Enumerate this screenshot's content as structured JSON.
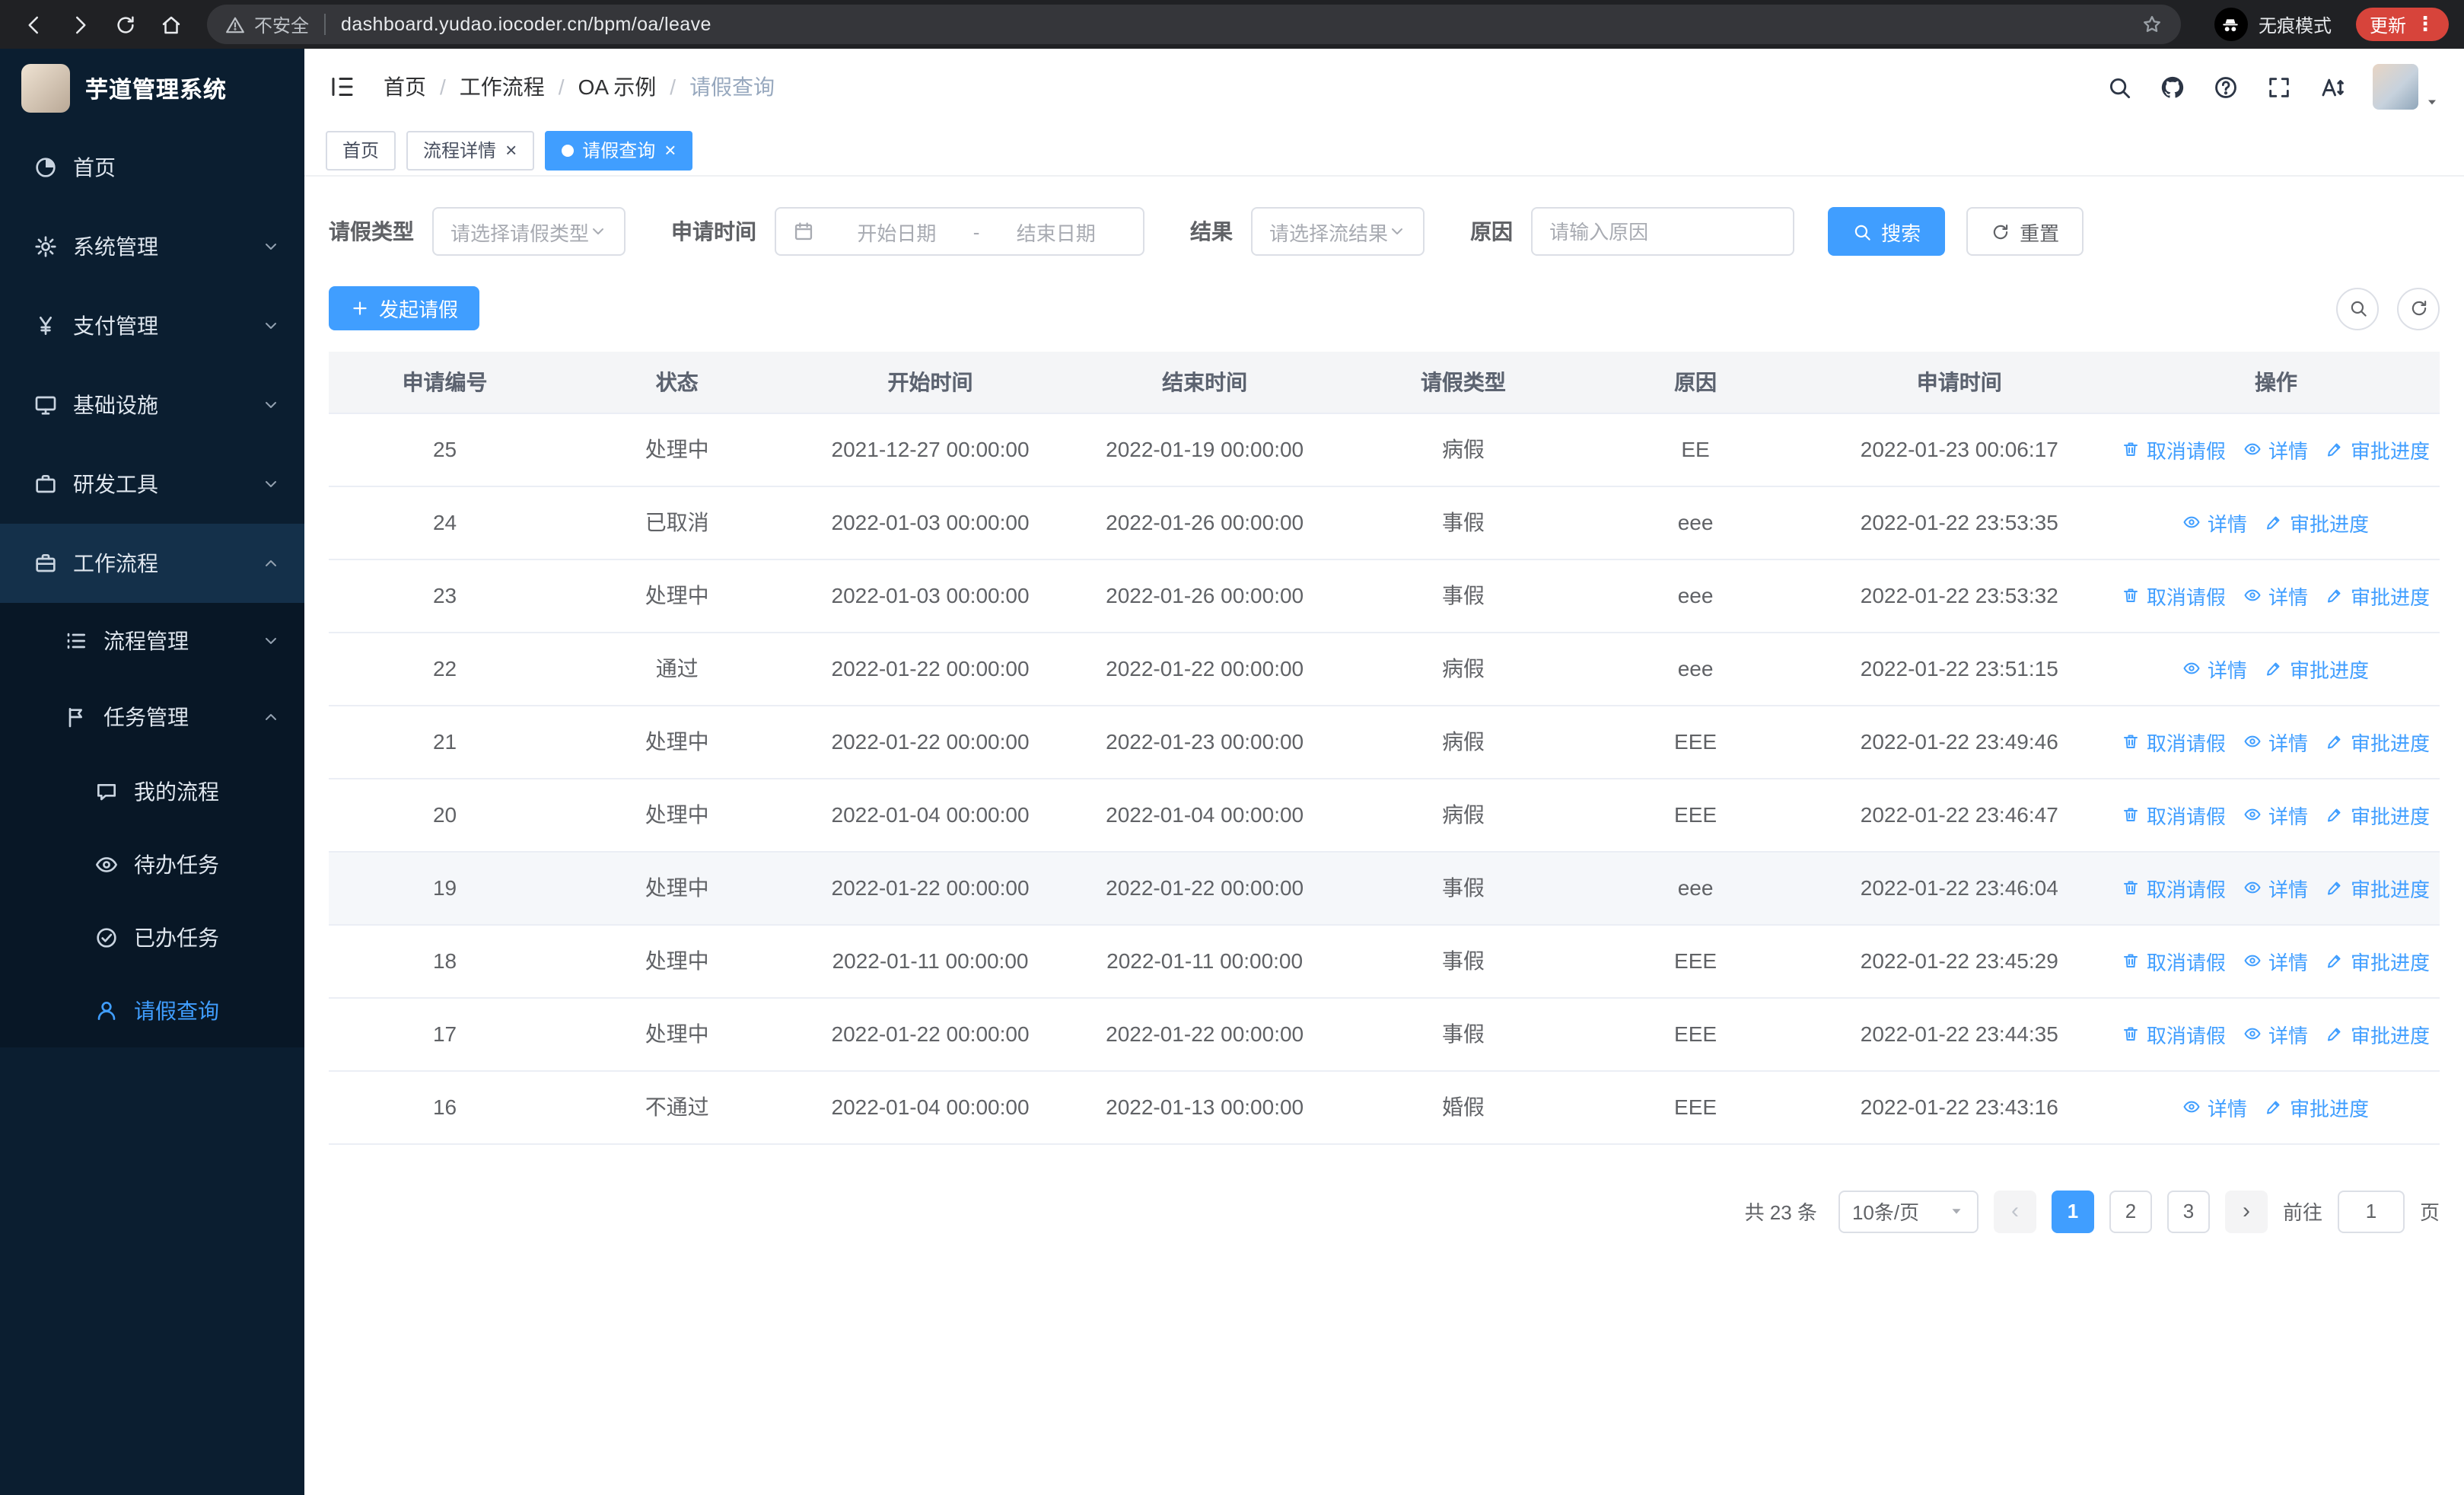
{
  "browser": {
    "security_label": "不安全",
    "url": "dashboard.yudao.iocoder.cn/bpm/oa/leave",
    "incognito_label": "无痕模式",
    "update_label": "更新"
  },
  "sidebar": {
    "logo_title": "芋道管理系统",
    "items": [
      {
        "key": "home",
        "label": "首页",
        "icon": "dashboard-icon",
        "level": 1
      },
      {
        "key": "system",
        "label": "系统管理",
        "icon": "gear-icon",
        "level": 1,
        "chevron": "down"
      },
      {
        "key": "payment",
        "label": "支付管理",
        "icon": "yen-icon",
        "level": 1,
        "chevron": "down"
      },
      {
        "key": "infrastructure",
        "label": "基础设施",
        "icon": "monitor-icon",
        "level": 1,
        "chevron": "down"
      },
      {
        "key": "devtools",
        "label": "研发工具",
        "icon": "briefcase-icon",
        "level": 1,
        "chevron": "down"
      },
      {
        "key": "workflow",
        "label": "工作流程",
        "icon": "workflow-icon",
        "level": 1,
        "chevron": "up",
        "highlight": true
      },
      {
        "key": "process-management",
        "label": "流程管理",
        "icon": "list-icon",
        "level": 2,
        "chevron": "down"
      },
      {
        "key": "task-management",
        "label": "任务管理",
        "icon": "flag-icon",
        "level": 2,
        "chevron": "up"
      },
      {
        "key": "my-process",
        "label": "我的流程",
        "icon": "chat-icon",
        "level": 3
      },
      {
        "key": "todo-task",
        "label": "待办任务",
        "icon": "eye-icon",
        "level": 3
      },
      {
        "key": "done-task",
        "label": "已办任务",
        "icon": "check-icon",
        "level": 3
      },
      {
        "key": "leave-query",
        "label": "请假查询",
        "icon": "user-icon",
        "level": 3,
        "active": true
      }
    ]
  },
  "header": {
    "breadcrumb": [
      "首页",
      "工作流程",
      "OA 示例",
      "请假查询"
    ]
  },
  "tabs": [
    {
      "label": "首页",
      "closable": false,
      "active": false
    },
    {
      "label": "流程详情",
      "closable": true,
      "active": false
    },
    {
      "label": "请假查询",
      "closable": true,
      "active": true
    }
  ],
  "filters": {
    "leave_type": {
      "label": "请假类型",
      "placeholder": "请选择请假类型"
    },
    "apply_time": {
      "label": "申请时间",
      "start_placeholder": "开始日期",
      "separator": "-",
      "end_placeholder": "结束日期"
    },
    "result": {
      "label": "结果",
      "placeholder": "请选择流结果"
    },
    "reason": {
      "label": "原因",
      "placeholder": "请输入原因"
    },
    "search_label": "搜索",
    "reset_label": "重置"
  },
  "toolbar": {
    "create_label": "发起请假"
  },
  "table": {
    "columns": [
      "申请编号",
      "状态",
      "开始时间",
      "结束时间",
      "请假类型",
      "原因",
      "申请时间",
      "操作"
    ],
    "column_keys": [
      "id",
      "status",
      "start",
      "end",
      "type",
      "reason",
      "applied"
    ],
    "action_labels": {
      "cancel": "取消请假",
      "detail": "详情",
      "progress": "审批进度"
    },
    "rows": [
      {
        "id": "25",
        "status": "处理中",
        "start": "2021-12-27 00:00:00",
        "end": "2022-01-19 00:00:00",
        "type": "病假",
        "reason": "EE",
        "applied": "2022-01-23 00:06:17",
        "actions": [
          "cancel",
          "detail",
          "progress"
        ]
      },
      {
        "id": "24",
        "status": "已取消",
        "start": "2022-01-03 00:00:00",
        "end": "2022-01-26 00:00:00",
        "type": "事假",
        "reason": "eee",
        "applied": "2022-01-22 23:53:35",
        "actions": [
          "detail",
          "progress"
        ]
      },
      {
        "id": "23",
        "status": "处理中",
        "start": "2022-01-03 00:00:00",
        "end": "2022-01-26 00:00:00",
        "type": "事假",
        "reason": "eee",
        "applied": "2022-01-22 23:53:32",
        "actions": [
          "cancel",
          "detail",
          "progress"
        ]
      },
      {
        "id": "22",
        "status": "通过",
        "start": "2022-01-22 00:00:00",
        "end": "2022-01-22 00:00:00",
        "type": "病假",
        "reason": "eee",
        "applied": "2022-01-22 23:51:15",
        "actions": [
          "detail",
          "progress"
        ]
      },
      {
        "id": "21",
        "status": "处理中",
        "start": "2022-01-22 00:00:00",
        "end": "2022-01-23 00:00:00",
        "type": "病假",
        "reason": "EEE",
        "applied": "2022-01-22 23:49:46",
        "actions": [
          "cancel",
          "detail",
          "progress"
        ]
      },
      {
        "id": "20",
        "status": "处理中",
        "start": "2022-01-04 00:00:00",
        "end": "2022-01-04 00:00:00",
        "type": "病假",
        "reason": "EEE",
        "applied": "2022-01-22 23:46:47",
        "actions": [
          "cancel",
          "detail",
          "progress"
        ]
      },
      {
        "id": "19",
        "status": "处理中",
        "start": "2022-01-22 00:00:00",
        "end": "2022-01-22 00:00:00",
        "type": "事假",
        "reason": "eee",
        "applied": "2022-01-22 23:46:04",
        "actions": [
          "cancel",
          "detail",
          "progress"
        ],
        "hovered": true
      },
      {
        "id": "18",
        "status": "处理中",
        "start": "2022-01-11 00:00:00",
        "end": "2022-01-11 00:00:00",
        "type": "事假",
        "reason": "EEE",
        "applied": "2022-01-22 23:45:29",
        "actions": [
          "cancel",
          "detail",
          "progress"
        ]
      },
      {
        "id": "17",
        "status": "处理中",
        "start": "2022-01-22 00:00:00",
        "end": "2022-01-22 00:00:00",
        "type": "事假",
        "reason": "EEE",
        "applied": "2022-01-22 23:44:35",
        "actions": [
          "cancel",
          "detail",
          "progress"
        ]
      },
      {
        "id": "16",
        "status": "不通过",
        "start": "2022-01-04 00:00:00",
        "end": "2022-01-13 00:00:00",
        "type": "婚假",
        "reason": "EEE",
        "applied": "2022-01-22 23:43:16",
        "actions": [
          "detail",
          "progress"
        ]
      }
    ]
  },
  "pagination": {
    "total_label": "共 23 条",
    "page_size_label": "10条/页",
    "pages": [
      "1",
      "2",
      "3"
    ],
    "active_page": "1",
    "goto_label": "前往",
    "goto_value": "1",
    "page_unit_label": "页"
  },
  "colors": {
    "primary": "#409eff",
    "sidebar_bg": "#0b1e30",
    "chrome_bg": "#202124",
    "update_red": "#d7443b"
  }
}
